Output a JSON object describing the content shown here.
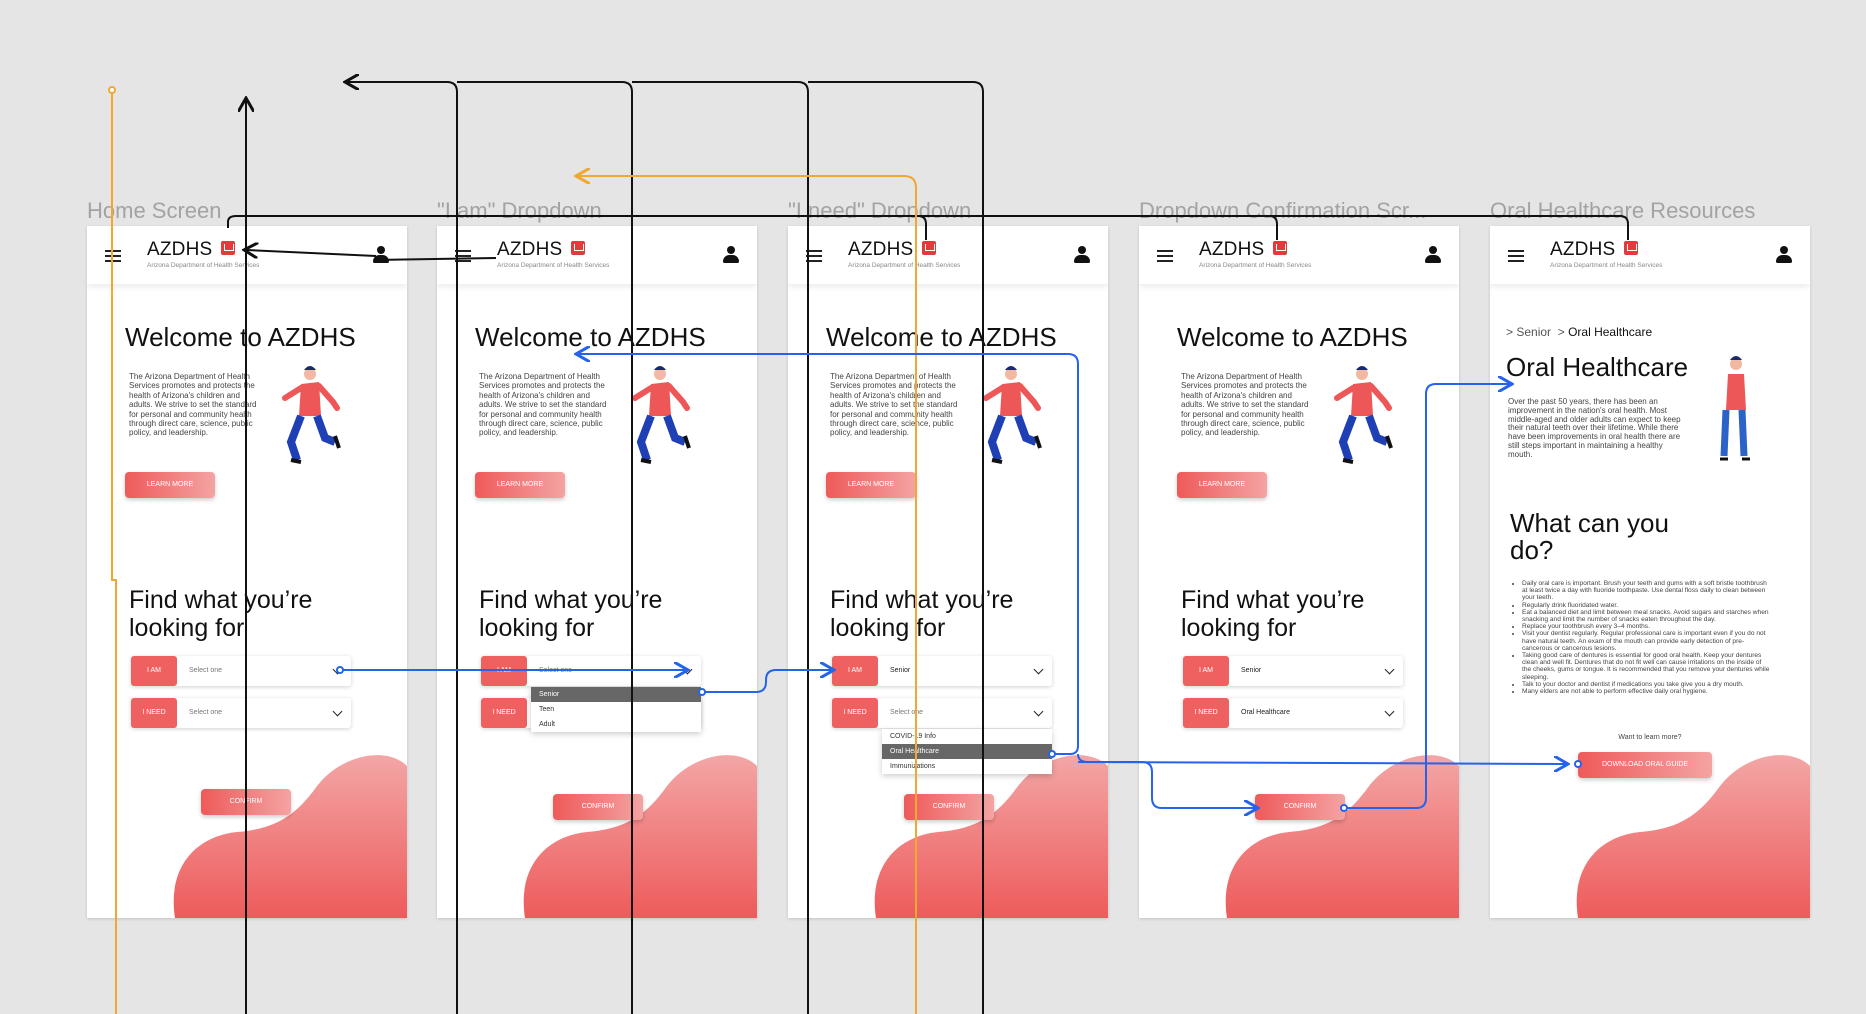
{
  "frames": [
    {
      "label": "Home Screen"
    },
    {
      "label": "\"I am\" Dropdown"
    },
    {
      "label": "\"I need\" Dropdown"
    },
    {
      "label": "Dropdown Confirmation Scr..."
    },
    {
      "label": "Oral Healthcare Resources"
    }
  ],
  "header": {
    "brand": "AZDHS",
    "subtitle": "Arizona Department of Health Services"
  },
  "home": {
    "welcome": "Welcome to AZDHS",
    "paragraph": "The Arizona Department of Health Services promotes and protects the health of Arizona's children and adults. We strive to set the standard for personal and community health through direct care, science, public policy, and leadership.",
    "learn_more": "LEARN MORE",
    "find_title": "Find what you’re looking for",
    "i_am_label": "I AM",
    "i_need_label": "I NEED",
    "select_placeholder": "Select one",
    "confirm": "CONFIRM"
  },
  "dropdowns": {
    "i_am_options": [
      "Senior",
      "Teen",
      "Adult"
    ],
    "i_need_options": [
      "COVID-19 Info",
      "Oral Healthcare",
      "Immunizations"
    ],
    "selected_i_am": "Senior",
    "selected_i_need": "Oral Healthcare"
  },
  "oral": {
    "crumb_parent": "Senior",
    "crumb_current": "Oral Healthcare",
    "title": "Oral Healthcare",
    "paragraph": "Over the past 50 years, there has been an improvement in the nation's oral health. Most middle-aged and older adults can expect to keep their natural teeth over their lifetime. While there have been improvements in oral health there are still steps important in maintaining a healthy mouth.",
    "what_title": "What can you do?",
    "tips": [
      "Daily oral care is important. Brush your teeth and gums with a soft bristle toothbrush at least twice a day with fluoride toothpaste. Use dental floss daily to clean between your teeth.",
      "Regularly drink fluoridated water.",
      "Eat a balanced diet and limit between meal snacks. Avoid sugars and starches when snacking and limit the number of snacks eaten throughout the day.",
      "Replace your toothbrush every 3–4 months.",
      "Visit your dentist regularly. Regular professional care is important even if you do not have natural teeth. An exam of the mouth can provide early detection of pre-cancerous or cancerous lesions.",
      "Taking good care of dentures is essential for good oral health. Keep your dentures clean and well fit. Dentures that do not fit well can cause irritations on the inside of the cheeks, gums or tongue. It is recommended that you remove your dentures while sleeping.",
      "Talk to your doctor and dentist if medications you take give you a dry mouth.",
      "Many elders are not able to perform effective daily oral hygiene."
    ],
    "want_more": "Want to learn more?",
    "download": "DOWNLOAD ORAL GUIDE"
  },
  "colors": {
    "canvas": "#e5e5e5",
    "accent_red": "#ef5a5a",
    "wire_blue": "#2563eb",
    "wire_black": "#111111",
    "wire_orange": "#f0a830"
  }
}
